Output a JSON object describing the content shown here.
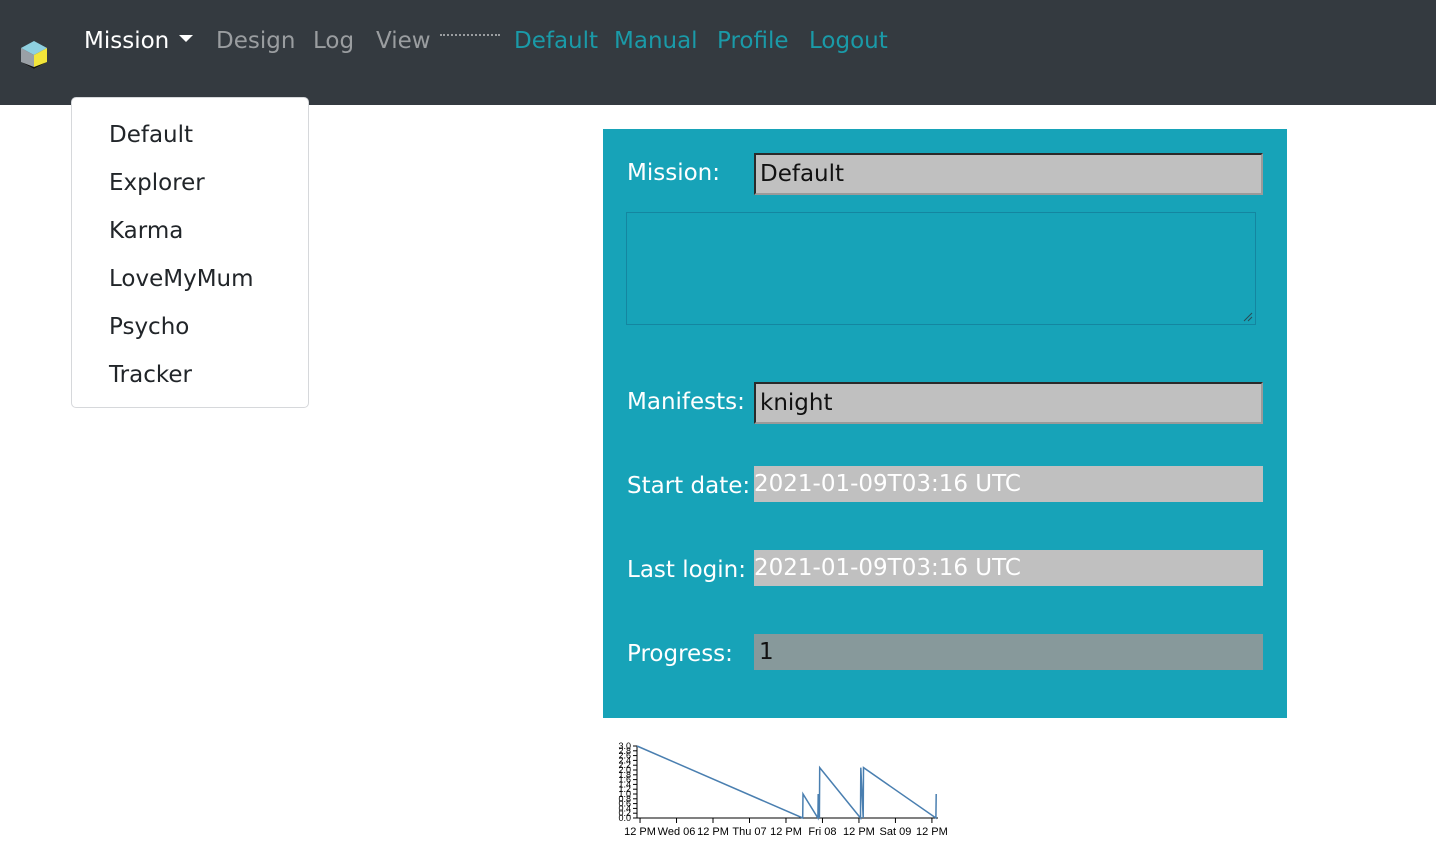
{
  "navbar": {
    "brand_icon": "cube-logo-icon",
    "mission_label": "Mission",
    "design_label": "Design",
    "log_label": "Log",
    "view_label": "View",
    "default_label": "Default",
    "manual_label": "Manual",
    "profile_label": "Profile",
    "logout_label": "Logout"
  },
  "dropdown": {
    "items": [
      {
        "label": "Default"
      },
      {
        "label": "Explorer"
      },
      {
        "label": "Karma"
      },
      {
        "label": "LoveMyMum"
      },
      {
        "label": "Psycho"
      },
      {
        "label": "Tracker"
      }
    ]
  },
  "panel": {
    "mission_label": "Mission:",
    "mission_value": "Default",
    "description_value": "",
    "manifests_label": "Manifests:",
    "manifests_value": "knight",
    "start_date_label": "Start date:",
    "start_date_value": "2021-01-09T03:16 UTC",
    "last_login_label": "Last login:",
    "last_login_value": "2021-01-09T03:16 UTC",
    "progress_label": "Progress:",
    "progress_value": "1"
  },
  "colors": {
    "navbar_bg": "#343a40",
    "panel_bg": "#17a3b8",
    "link": "#1a9aa8",
    "series": "#4a7fb0"
  },
  "chart_data": {
    "type": "line",
    "title": "",
    "xlabel": "",
    "ylabel": "",
    "ylim": [
      0,
      3.0
    ],
    "yticks": [
      "0.0",
      "0.2",
      "0.4",
      "0.6",
      "0.8",
      "1.0",
      "1.2",
      "1.4",
      "1.6",
      "1.8",
      "2.0",
      "2.2",
      "2.4",
      "2.6",
      "2.8",
      "3.0"
    ],
    "xticks": [
      {
        "t": 0,
        "label": "12 PM"
      },
      {
        "t": 12,
        "label": "Wed 06"
      },
      {
        "t": 24,
        "label": "12 PM"
      },
      {
        "t": 36,
        "label": "Thu 07"
      },
      {
        "t": 48,
        "label": "12 PM"
      },
      {
        "t": 60,
        "label": "Fri 08"
      },
      {
        "t": 72,
        "label": "12 PM"
      },
      {
        "t": 84,
        "label": "Sat 09"
      },
      {
        "t": 96,
        "label": "12 PM"
      }
    ],
    "xlim": [
      -1,
      98
    ],
    "series": [
      {
        "points": [
          [
            -1,
            3.0
          ],
          [
            53.5,
            0.0
          ],
          [
            53.6,
            1.0
          ],
          [
            58.5,
            0.0
          ],
          [
            58.6,
            1.0
          ],
          [
            59,
            0.0
          ],
          [
            59.1,
            2.1
          ],
          [
            72.5,
            0.0
          ],
          [
            72.6,
            2.1
          ],
          [
            73.4,
            0.0
          ],
          [
            73.5,
            2.1
          ],
          [
            97.3,
            0.0
          ],
          [
            97.4,
            1.0
          ]
        ]
      }
    ]
  }
}
